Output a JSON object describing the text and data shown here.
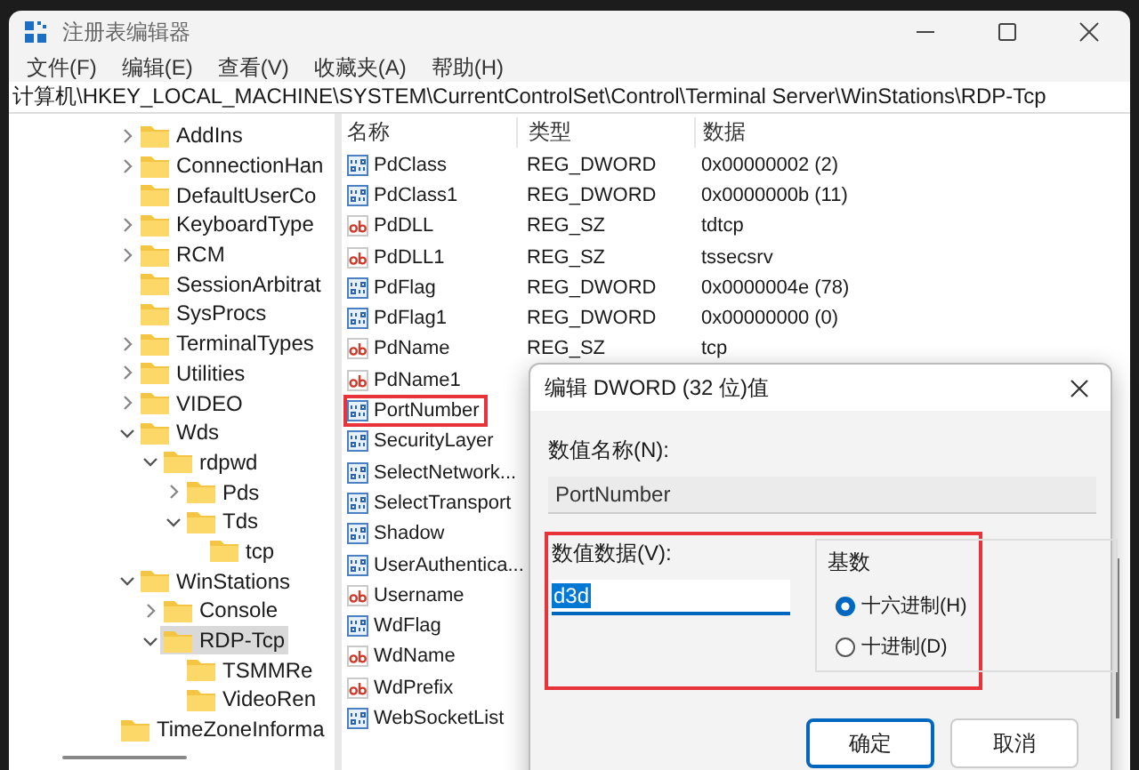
{
  "window": {
    "title": "注册表编辑器"
  },
  "menu": [
    "文件(F)",
    "编辑(E)",
    "查看(V)",
    "收藏夹(A)",
    "帮助(H)"
  ],
  "address": "计算机\\HKEY_LOCAL_MACHINE\\SYSTEM\\CurrentControlSet\\Control\\Terminal Server\\WinStations\\RDP-Tcp",
  "tree": {
    "items": [
      {
        "label": "AddIns",
        "expanded": false,
        "selected": false
      },
      {
        "label": "ConnectionHan",
        "expanded": false,
        "selected": false
      },
      {
        "label": "DefaultUserCo",
        "selected": false
      },
      {
        "label": "KeyboardType",
        "expanded": false,
        "selected": false
      },
      {
        "label": "RCM",
        "expanded": false,
        "selected": false
      },
      {
        "label": "SessionArbitrat",
        "selected": false
      },
      {
        "label": "SysProcs",
        "selected": false
      },
      {
        "label": "TerminalTypes",
        "expanded": false,
        "selected": false
      },
      {
        "label": "Utilities",
        "expanded": false,
        "selected": false
      },
      {
        "label": "VIDEO",
        "expanded": false,
        "selected": false
      },
      {
        "label": "Wds",
        "expanded": true,
        "selected": false,
        "children": [
          {
            "label": "rdpwd",
            "expanded": true,
            "selected": false,
            "children": [
              {
                "label": "Pds",
                "expanded": false,
                "selected": false
              },
              {
                "label": "Tds",
                "expanded": true,
                "selected": false,
                "children": [
                  {
                    "label": "tcp",
                    "selected": false
                  }
                ]
              }
            ]
          }
        ]
      },
      {
        "label": "WinStations",
        "expanded": true,
        "selected": false,
        "children": [
          {
            "label": "Console",
            "expanded": false,
            "selected": false
          },
          {
            "label": "RDP-Tcp",
            "expanded": true,
            "selected": true,
            "children": [
              {
                "label": "TSMMRe",
                "selected": false
              },
              {
                "label": "VideoRen",
                "selected": false
              }
            ]
          }
        ]
      }
    ],
    "following_items": [
      {
        "label": "TimeZoneInforma",
        "selected": false
      }
    ]
  },
  "values": {
    "columns": [
      "名称",
      "类型",
      "数据"
    ],
    "rows": [
      {
        "kind": "dword",
        "name": "PdClass",
        "type": "REG_DWORD",
        "data": "0x00000002 (2)",
        "selected": false
      },
      {
        "kind": "dword",
        "name": "PdClass1",
        "type": "REG_DWORD",
        "data": "0x0000000b (11)",
        "selected": false
      },
      {
        "kind": "sz",
        "name": "PdDLL",
        "type": "REG_SZ",
        "data": "tdtcp",
        "selected": false
      },
      {
        "kind": "sz",
        "name": "PdDLL1",
        "type": "REG_SZ",
        "data": "tssecsrv",
        "selected": false
      },
      {
        "kind": "dword",
        "name": "PdFlag",
        "type": "REG_DWORD",
        "data": "0x0000004e (78)",
        "selected": false
      },
      {
        "kind": "dword",
        "name": "PdFlag1",
        "type": "REG_DWORD",
        "data": "0x00000000 (0)",
        "selected": false
      },
      {
        "kind": "sz",
        "name": "PdName",
        "type": "REG_SZ",
        "data": "tcp",
        "selected": false
      },
      {
        "kind": "sz",
        "name": "PdName1",
        "selected": false
      },
      {
        "kind": "dword",
        "name": "PortNumber",
        "selected": true
      },
      {
        "kind": "dword",
        "name": "SecurityLayer",
        "selected": false
      },
      {
        "kind": "dword",
        "name": "SelectNetwork...",
        "selected": false
      },
      {
        "kind": "dword",
        "name": "SelectTransport",
        "selected": false
      },
      {
        "kind": "dword",
        "name": "Shadow",
        "selected": false
      },
      {
        "kind": "dword",
        "name": "UserAuthentica...",
        "selected": false
      },
      {
        "kind": "sz",
        "name": "Username",
        "selected": false
      },
      {
        "kind": "dword",
        "name": "WdFlag",
        "selected": false
      },
      {
        "kind": "sz",
        "name": "WdName",
        "selected": false
      },
      {
        "kind": "sz",
        "name": "WdPrefix",
        "selected": false
      },
      {
        "kind": "dword",
        "name": "WebSocketList",
        "selected": false
      }
    ]
  },
  "dialog": {
    "title": "编辑 DWORD (32 位)值",
    "name_label": "数值名称(N):",
    "name_value": "PortNumber",
    "data_label": "数值数据(V):",
    "data_value": "d3d",
    "highlighted": true,
    "base_label": "基数",
    "radios": [
      {
        "label": "十六进制(H)",
        "selected": true
      },
      {
        "label": "十进制(D)",
        "selected": false
      }
    ],
    "buttons": [
      {
        "label": "确定",
        "default": true
      },
      {
        "label": "取消",
        "default": false
      }
    ]
  }
}
